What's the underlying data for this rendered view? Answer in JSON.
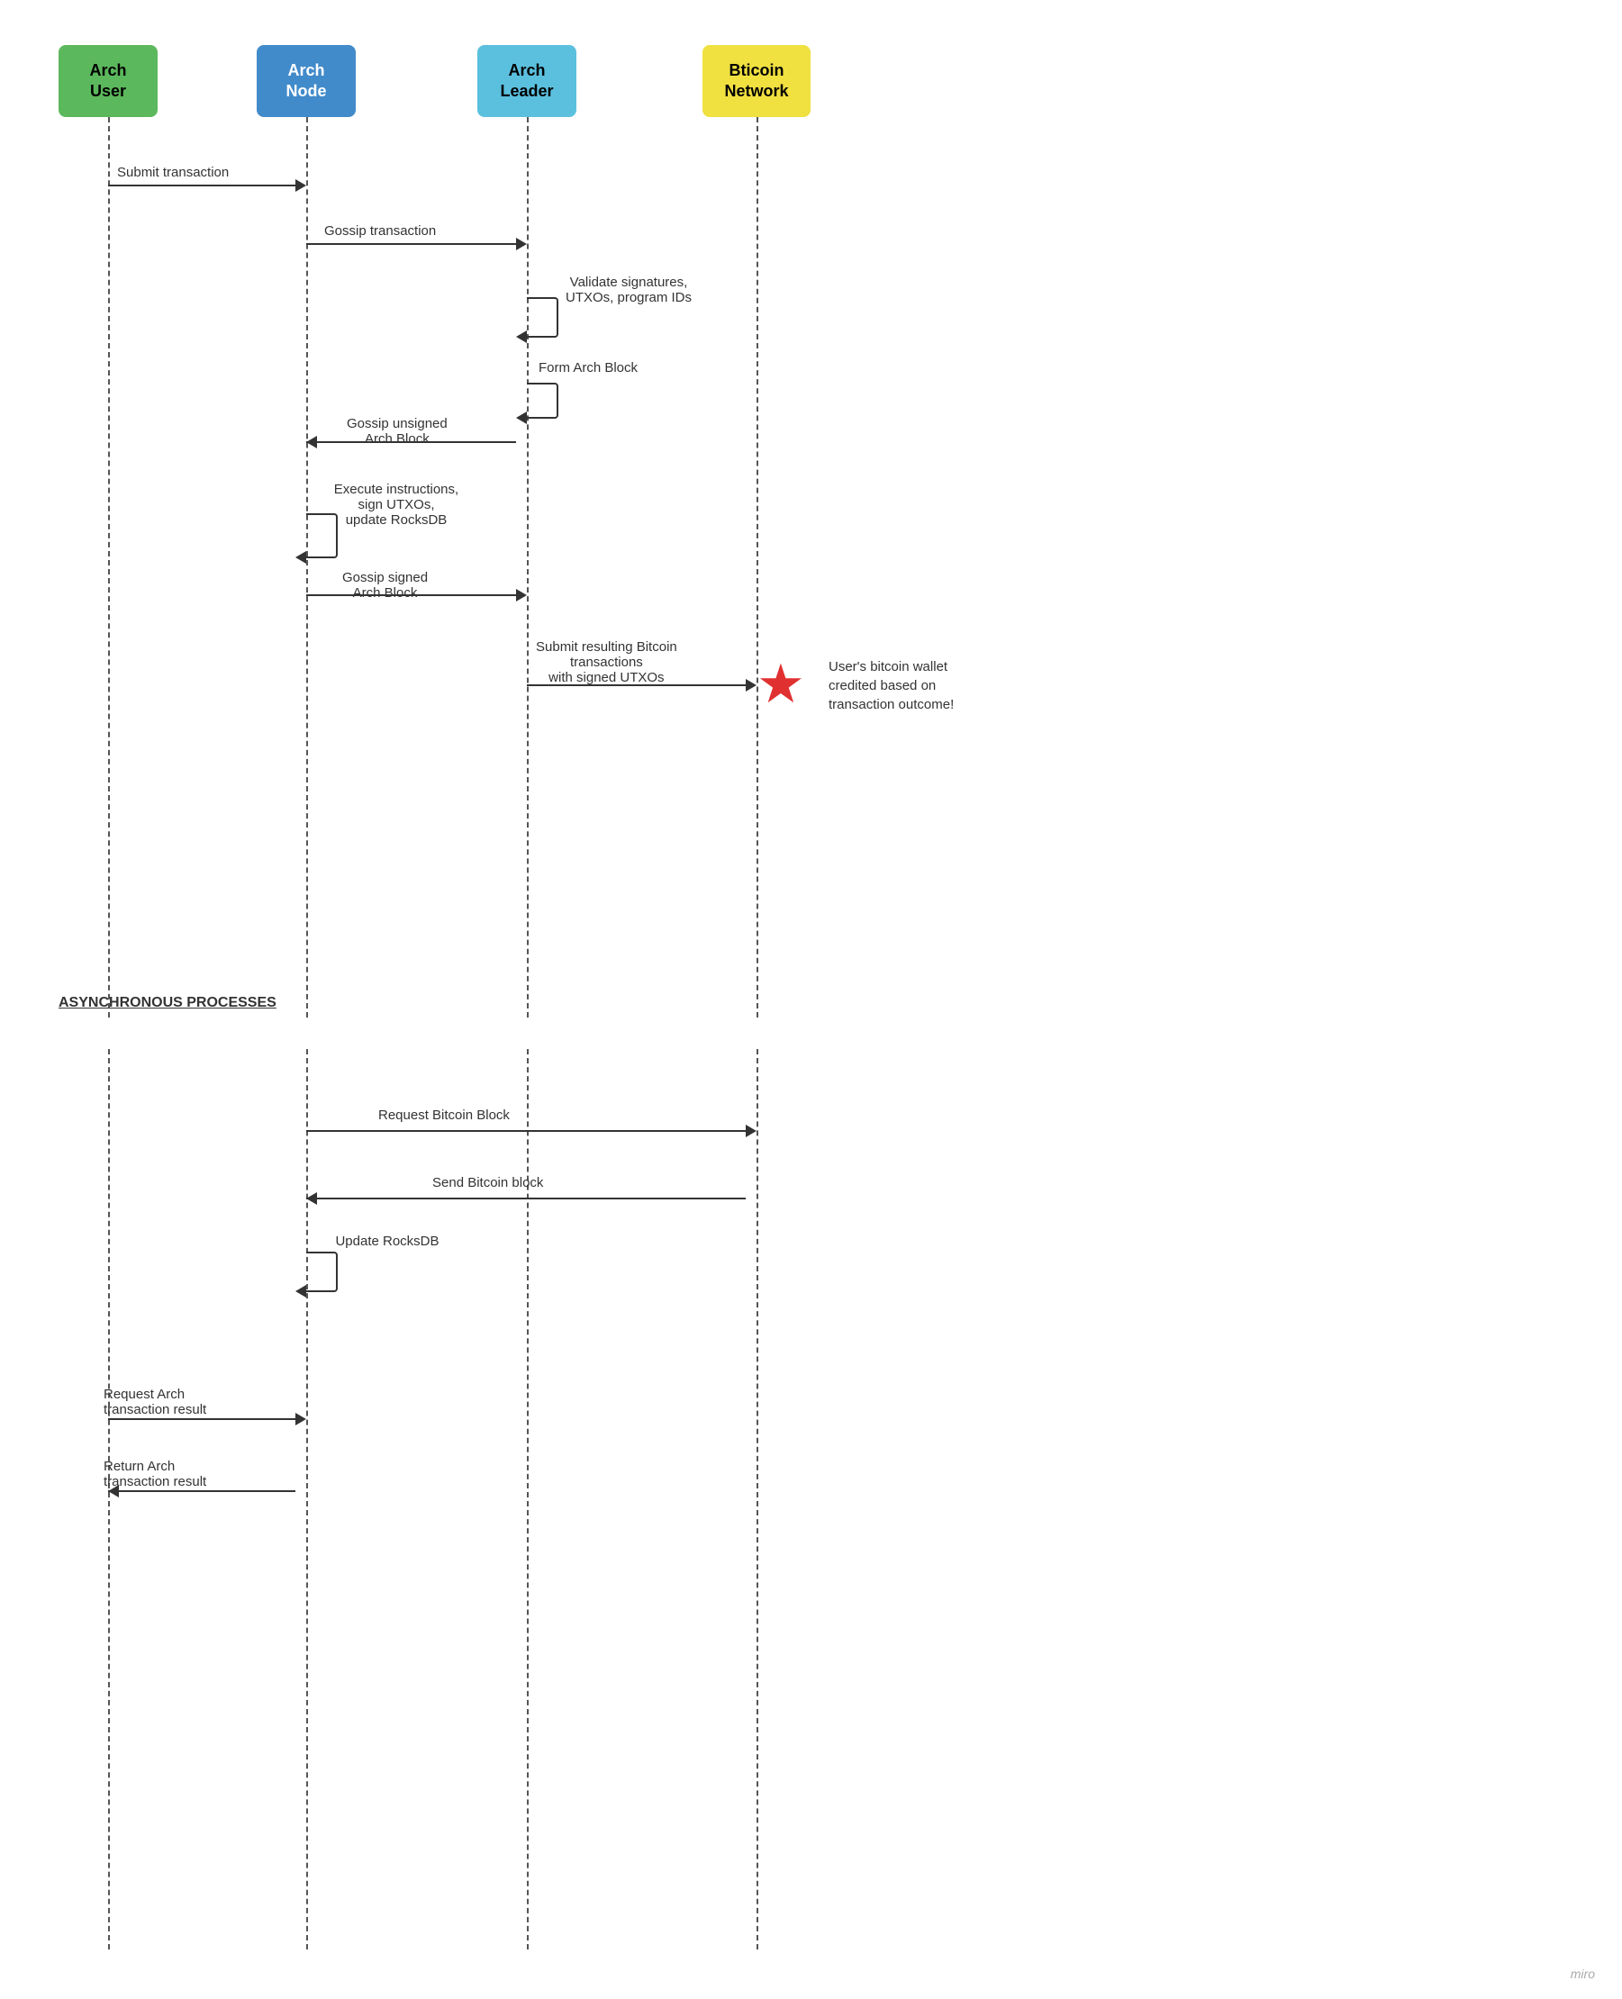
{
  "actors": {
    "arch_user": {
      "label": "Arch\nUser",
      "bg": "#5cb85c",
      "color": "#000"
    },
    "arch_node": {
      "label": "Arch\nNode",
      "bg": "#428bca",
      "color": "#fff"
    },
    "arch_leader": {
      "label": "Arch\nLeader",
      "bg": "#5bc0de",
      "color": "#000"
    },
    "bitcoin_network": {
      "label": "Bticoin\nNetwork",
      "bg": "#f0e040",
      "color": "#000"
    }
  },
  "section_label": "ASYNCHRONOUS PROCESSES",
  "watermark": "miro",
  "messages": [
    {
      "id": "submit-transaction",
      "label": "Submit transaction"
    },
    {
      "id": "gossip-transaction",
      "label": "Gossip transaction"
    },
    {
      "id": "validate-self",
      "label": "Validate signatures,\nUTXOs, program IDs"
    },
    {
      "id": "form-arch-block",
      "label": "Form Arch Block"
    },
    {
      "id": "gossip-unsigned-arch-block",
      "label": "Gossip unsigned\nArch Block"
    },
    {
      "id": "execute-instructions",
      "label": "Execute instructions,\nsign UTXOs,\nupdate RocksDB"
    },
    {
      "id": "gossip-signed-arch-block",
      "label": "Gossip signed\nArch Block"
    },
    {
      "id": "submit-resulting",
      "label": "Submit resulting Bitcoin\ntransactions\nwith signed UTXOs"
    },
    {
      "id": "bitcoin-wallet-note",
      "label": "User's bitcoin wallet\ncredited based on\ntransaction outcome!"
    },
    {
      "id": "request-bitcoin-block",
      "label": "Request Bitcoin Block"
    },
    {
      "id": "send-bitcoin-block",
      "label": "Send Bitcoin block"
    },
    {
      "id": "update-rocksdb",
      "label": "Update RocksDB"
    },
    {
      "id": "request-arch-tx-result",
      "label": "Request Arch\ntransaction result"
    },
    {
      "id": "return-arch-tx-result",
      "label": "Return Arch\ntransaction result"
    }
  ]
}
